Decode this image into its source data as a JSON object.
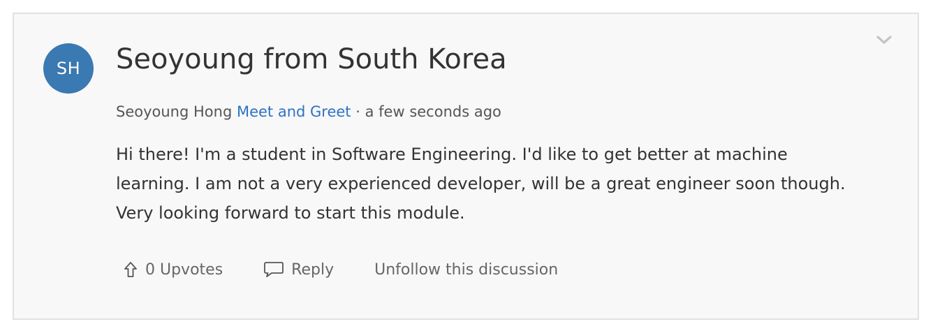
{
  "post": {
    "avatar_initials": "SH",
    "title": "Seoyoung from South Korea",
    "author": "Seoyoung Hong",
    "category": "Meet and Greet",
    "separator": "·",
    "timestamp": "a few seconds ago",
    "body": "Hi there! I'm a student in Software Engineering. I'd like to get better at machine learning. I am not a very experienced developer, will be a great engineer soon though. Very looking forward to start this module."
  },
  "actions": {
    "upvotes_label": "0 Upvotes",
    "reply_label": "Reply",
    "unfollow_label": "Unfollow this discussion"
  },
  "icons": {
    "collapse": "chevron-down-icon",
    "upvote": "arrow-up-icon",
    "reply": "speech-bubble-icon"
  },
  "colors": {
    "avatar_bg": "#3a79b1",
    "link": "#2d72c4",
    "card_bg": "#f8f8f8",
    "card_border": "#e1e1e1"
  }
}
